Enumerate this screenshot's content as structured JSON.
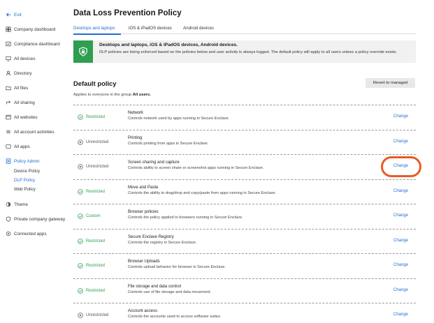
{
  "sidebar": {
    "exit": "Exit",
    "items": [
      {
        "label": "Company dashboard",
        "icon": "dashboard-icon"
      },
      {
        "label": "Compliance dashboard",
        "icon": "compliance-icon"
      },
      {
        "label": "All devices",
        "icon": "devices-icon"
      },
      {
        "label": "Directory",
        "icon": "directory-icon"
      },
      {
        "label": "All files",
        "icon": "folder-icon"
      },
      {
        "label": "All sharing",
        "icon": "sharing-icon"
      },
      {
        "label": "All websites",
        "icon": "websites-icon"
      },
      {
        "label": "All account activities",
        "icon": "activities-icon"
      },
      {
        "label": "All apps",
        "icon": "apps-icon"
      },
      {
        "label": "Policy Admin",
        "icon": "policy-icon"
      },
      {
        "label": "Theme",
        "icon": "theme-icon"
      },
      {
        "label": "Private company gateway",
        "icon": "gateway-icon"
      },
      {
        "label": "Connected apps",
        "icon": "connected-apps-icon"
      }
    ],
    "subitems": [
      "Device Policy",
      "DLP Policy",
      "Web Policy"
    ]
  },
  "main": {
    "title": "Data Loss Prevention Policy",
    "tabs": [
      "Desktops and laptops",
      "iOS & iPadOS devices",
      "Android devices"
    ],
    "banner": {
      "title": "Desktops and laptops, iOS & iPadOS devices, Android devices.",
      "text": "DLP policies are being enforced based on the policies below and user activity is always logged. The default policy will apply to all users unless a policy override exists."
    },
    "section_title": "Default policy",
    "revert_label": "Revert to managed",
    "applies_prefix": "Applies to everyone in the group",
    "applies_group": "All users."
  },
  "policies": [
    {
      "status": "Restricted",
      "name": "Network",
      "desc": "Controls network used by apps running in Secure Enclave.",
      "action": "Change"
    },
    {
      "status": "Unrestricted",
      "name": "Printing",
      "desc": "Controls printing from apps in Secure Enclave.",
      "action": "Change"
    },
    {
      "status": "Unrestricted",
      "name": "Screen sharing and capture",
      "desc": "Controls ability to screen share or screenshot apps running in Secure Enclave.",
      "action": "Change"
    },
    {
      "status": "Restricted",
      "name": "Move and Paste",
      "desc": "Controls the ability to drag/drop and copy/paste from apps running in Secure Enclave.",
      "action": "Change"
    },
    {
      "status": "Custom",
      "name": "Browser policies",
      "desc": "Controls the policy applied to browsers running in Secure Enclave.",
      "action": "Change"
    },
    {
      "status": "Restricted",
      "name": "Secure Enclave Registry",
      "desc": "Controls the registry in Secure Enclave.",
      "action": "Change"
    },
    {
      "status": "Restricted",
      "name": "Browser Uploads",
      "desc": "Controls upload behavior for browser in Secure Enclave.",
      "action": "Change"
    },
    {
      "status": "Restricted",
      "name": "File storage and data control",
      "desc": "Controls use of file storage and data movement.",
      "action": "Change"
    },
    {
      "status": "Unrestricted",
      "name": "Account access",
      "desc": "Controls the accounts used to access software suites.",
      "action": "Change"
    }
  ],
  "colors": {
    "accent": "#1f6fd1",
    "restricted": "#2e9e4f",
    "highlight": "#e85b25"
  }
}
